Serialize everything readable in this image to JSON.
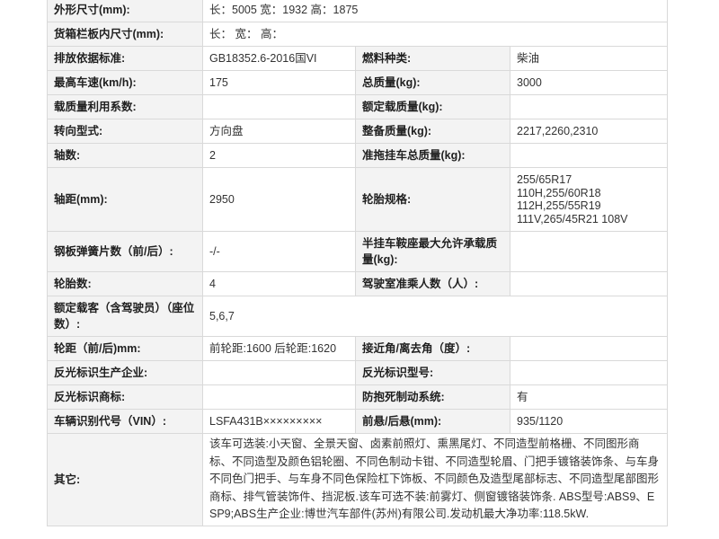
{
  "rows": [
    {
      "type": "span",
      "label": "外形尺寸(mm):",
      "value": "长：5005 宽：1932 高：1875"
    },
    {
      "type": "span",
      "label": "货箱栏板内尺寸(mm):",
      "value": "长： 宽： 高："
    },
    {
      "type": "pair",
      "label1": "排放依据标准:",
      "value1": "GB18352.6-2016国VI",
      "label2": "燃料种类:",
      "value2": "柴油"
    },
    {
      "type": "pair",
      "label1": "最高车速(km/h):",
      "value1": "175",
      "label2": "总质量(kg):",
      "value2": "3000"
    },
    {
      "type": "pair",
      "label1": "载质量利用系数:",
      "value1": "",
      "label2": "额定载质量(kg):",
      "value2": ""
    },
    {
      "type": "pair",
      "label1": "转向型式:",
      "value1": "方向盘",
      "label2": "整备质量(kg):",
      "value2": "2217,2260,2310"
    },
    {
      "type": "pair",
      "label1": "轴数:",
      "value1": "2",
      "label2": "准拖挂车总质量(kg):",
      "value2": ""
    }
  ],
  "wheelbase_row": {
    "label1": "轴距(mm):",
    "value1": "2950",
    "label2": "轮胎规格:",
    "tires": [
      "255/65R17",
      "110H,255/60R18",
      "112H,255/55R19",
      "111V,265/45R21 108V"
    ]
  },
  "rows2": [
    {
      "label1": "钢板弹簧片数（前/后）:",
      "value1": "-/-",
      "label2": "半挂车鞍座最大允许承载质量(kg):",
      "value2": ""
    },
    {
      "label1": "轮胎数:",
      "value1": "4",
      "label2": "驾驶室准乘人数（人）:",
      "value2": ""
    }
  ],
  "passenger_row": {
    "label": "额定载客（含驾驶员）（座位数）:",
    "value": "5,6,7"
  },
  "rows3": [
    {
      "label1": "轮距（前/后)mm:",
      "value1": "前轮距:1600 后轮距:1620",
      "label2": "接近角/离去角（度）:",
      "value2": ""
    },
    {
      "label1": "反光标识生产企业:",
      "value1": "",
      "label2": "反光标识型号:",
      "value2": ""
    },
    {
      "label1": "反光标识商标:",
      "value1": "",
      "label2": "防抱死制动系统:",
      "value2": "有"
    },
    {
      "label1": "车辆识别代号（VIN）:",
      "value1": "LSFA431B×××××××××",
      "label2": "前悬/后悬(mm):",
      "value2": "935/1120"
    }
  ],
  "other_row": {
    "label": "其它:",
    "value": "该车可选装:小天窗、全景天窗、卤素前照灯、熏黑尾灯、不同造型前格栅、不同图形商标、不同造型及颜色铝轮圈、不同色制动卡钳、不同造型轮眉、门把手镀铬装饰条、与车身不同色门把手、与车身不同色保险杠下饰板、不同颜色及造型尾部标志、不同造型尾部图形商标、排气管装饰件、挡泥板.该车可选不装:前雾灯、侧窗镀铬装饰条. ABS型号:ABS9、ESP9;ABS生产企业:博世汽车部件(苏州)有限公司.发动机最大净功率:118.5kW."
  }
}
